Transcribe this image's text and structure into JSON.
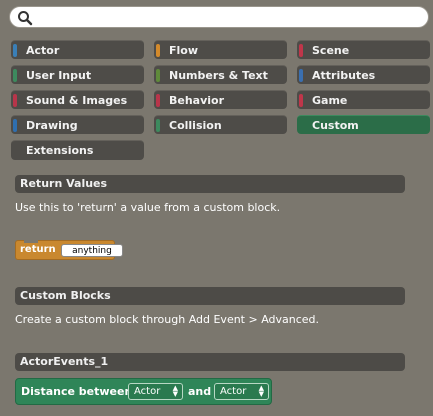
{
  "search": {
    "placeholder": "",
    "value": ""
  },
  "categories": [
    {
      "label": "Actor",
      "stripe": "#3a7fb7"
    },
    {
      "label": "Flow",
      "stripe": "#d38a2b"
    },
    {
      "label": "Scene",
      "stripe": "#c0364a"
    },
    {
      "label": "User Input",
      "stripe": "#3d8a5e"
    },
    {
      "label": "Numbers & Text",
      "stripe": "#5f8a3a"
    },
    {
      "label": "Attributes",
      "stripe": "#3a6fb0"
    },
    {
      "label": "Sound & Images",
      "stripe": "#b8354a"
    },
    {
      "label": "Behavior",
      "stripe": "#b8354a"
    },
    {
      "label": "Game",
      "stripe": "#c0364a"
    },
    {
      "label": "Drawing",
      "stripe": "#2f6fb0"
    },
    {
      "label": "Collision",
      "stripe": "#3d8a5e"
    },
    {
      "label": "Custom",
      "stripe": "#2b6d48",
      "selected": true
    },
    {
      "label": "Extensions",
      "stripe": ""
    }
  ],
  "sections": {
    "return_values": {
      "title": "Return Values",
      "description": "Use this to 'return' a value from a custom block."
    },
    "custom_blocks": {
      "title": "Custom Blocks",
      "description": "Create a custom block through Add Event > Advanced."
    },
    "actor_events": {
      "title": "ActorEvents_1"
    }
  },
  "return_block": {
    "label": "return",
    "slot": "anything",
    "color": "#c9882f"
  },
  "distance_block": {
    "label": "Distance between",
    "first_value": "Actor",
    "and_label": "and",
    "second_value": "Actor",
    "color": "#2f8558"
  }
}
